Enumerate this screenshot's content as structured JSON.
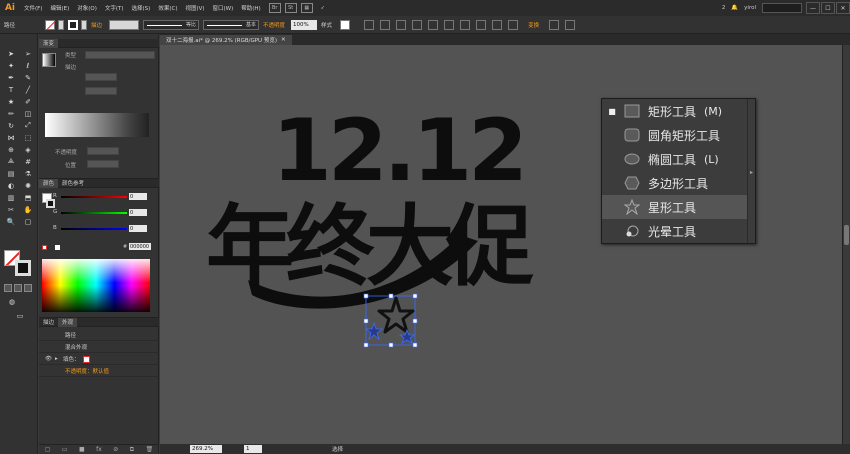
{
  "menubar": {
    "logo": "Ai",
    "items": [
      "文件(F)",
      "编辑(E)",
      "对象(O)",
      "文字(T)",
      "选择(S)",
      "效果(C)",
      "视图(V)",
      "窗口(W)",
      "帮助(H)"
    ],
    "workspace_count": "2",
    "user": "yirol",
    "window_controls": [
      "—",
      "☐",
      "✕"
    ]
  },
  "control": {
    "selection_label": "路径",
    "stroke_label": "描边",
    "stroke_profile": "等比",
    "brush": "基本",
    "opacity_label": "不透明度",
    "opacity_value": "100%",
    "style_label": "样式",
    "transform_label": "变换"
  },
  "panels": {
    "gradient_tabs": [
      "渐变"
    ],
    "gradient_type_label": "类型",
    "gradient_stroke_label": "描边",
    "gradient_opacity_label": "不透明度",
    "gradient_location_label": "位置",
    "color_tabs": [
      "颜色",
      "颜色参考"
    ],
    "channels": [
      "R",
      "G",
      "B"
    ],
    "channel_values": [
      "0",
      "0",
      "0"
    ],
    "hex_value": "000000",
    "appearance_tabs": [
      "描边",
      "外观"
    ],
    "appearance_rows": [
      "路径",
      "混合外观",
      "填色：",
      "不透明度：默认值"
    ]
  },
  "document": {
    "tab_title": "双十二海报.ai* @ 269.2% (RGB/GPU 预览)",
    "close": "✕",
    "artwork_top": "12.12",
    "artwork_bottom": "年终大促"
  },
  "status": {
    "zoom": "269.2%",
    "page": "1",
    "tool_label": "选择"
  },
  "flyout": {
    "items": [
      {
        "label": "矩形工具",
        "key": "(M)",
        "icon": "rectangle-icon",
        "active": true
      },
      {
        "label": "圆角矩形工具",
        "key": "",
        "icon": "rounded-rectangle-icon",
        "active": false
      },
      {
        "label": "椭圆工具",
        "key": "(L)",
        "icon": "ellipse-icon",
        "active": false
      },
      {
        "label": "多边形工具",
        "key": "",
        "icon": "polygon-icon",
        "active": false
      },
      {
        "label": "星形工具",
        "key": "",
        "icon": "star-icon",
        "active": false
      },
      {
        "label": "光晕工具",
        "key": "",
        "icon": "flare-icon",
        "active": false
      }
    ],
    "hovered": "星形工具"
  },
  "colors": {
    "accent_orange": "#f39a1d",
    "canvas_bg": "#535353",
    "artwork_fill": "#0d0d0d",
    "selection_blue": "#3a6cff"
  }
}
